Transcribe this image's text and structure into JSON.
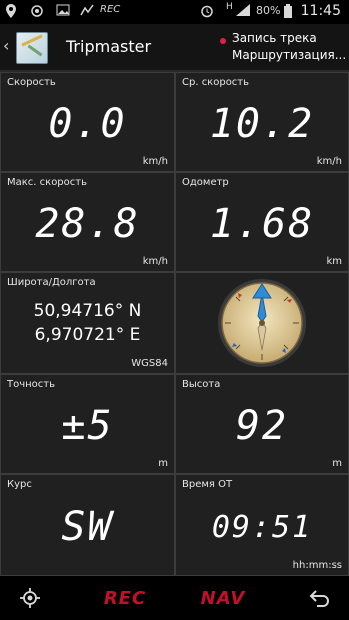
{
  "status_bar": {
    "rec": "REC",
    "signal_type": "H",
    "battery": "80%",
    "time": "11:45"
  },
  "action_bar": {
    "title": "Tripmaster",
    "track_line1": "Запись трека",
    "track_line2": "Маршрутизация..."
  },
  "tiles": {
    "speed": {
      "label": "Скорость",
      "value": "0.0",
      "unit": "km/h"
    },
    "avg_speed": {
      "label": "Ср. скорость",
      "value": "10.2",
      "unit": "km/h"
    },
    "max_speed": {
      "label": "Макс. скорость",
      "value": "28.8",
      "unit": "km/h"
    },
    "odometer": {
      "label": "Одометр",
      "value": "1.68",
      "unit": "km"
    },
    "position": {
      "label": "Широта/Долгота",
      "lat": "50,94716° N",
      "lon": "6,970721° E",
      "datum": "WGS84"
    },
    "accuracy": {
      "label": "Точность",
      "value": "±5",
      "unit": "m"
    },
    "altitude": {
      "label": "Высота",
      "value": "92",
      "unit": "m"
    },
    "course": {
      "label": "Курс",
      "value": "SW"
    },
    "time_ot": {
      "label": "Время ОТ",
      "value": "09:51",
      "unit": "hh:mm:ss"
    }
  },
  "compass": {
    "needle_color": "#2f8ad8",
    "face_color": "#e8d7a8"
  },
  "nav_bar": {
    "rec_label": "REC",
    "nav_label": "NAV"
  },
  "colors": {
    "accent_red": "#c0102a",
    "tile_bg": "#202020"
  }
}
